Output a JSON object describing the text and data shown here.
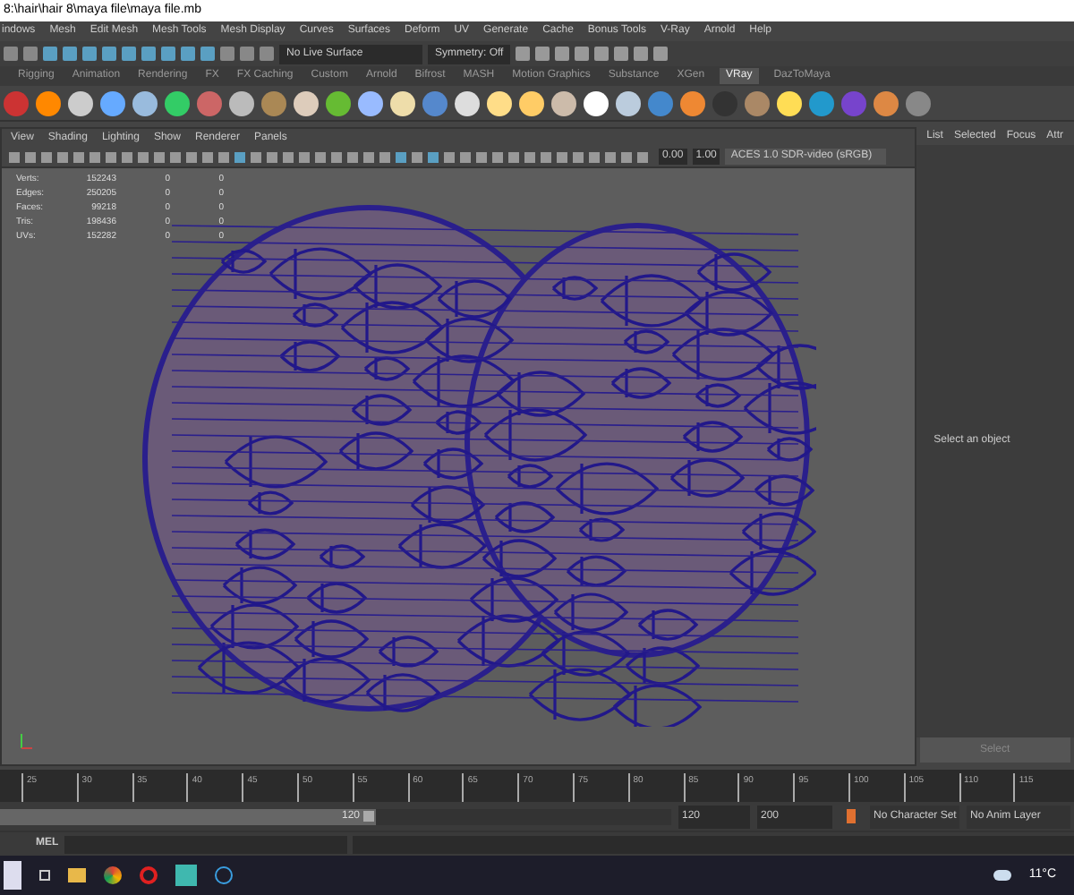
{
  "window": {
    "title": "8:\\hair\\hair 8\\maya file\\maya file.mb"
  },
  "menu_bar": [
    "indows",
    "Mesh",
    "Edit Mesh",
    "Mesh Tools",
    "Mesh Display",
    "Curves",
    "Surfaces",
    "Deform",
    "UV",
    "Generate",
    "Cache",
    "Bonus Tools",
    "V-Ray",
    "Arnold",
    "Help"
  ],
  "status_line": {
    "live_surface": "No Live Surface",
    "symmetry": "Symmetry: Off"
  },
  "shelf_tabs": [
    {
      "label": "Rigging",
      "selected": false
    },
    {
      "label": "Animation",
      "selected": false
    },
    {
      "label": "Rendering",
      "selected": false
    },
    {
      "label": "FX",
      "selected": false
    },
    {
      "label": "FX Caching",
      "selected": false
    },
    {
      "label": "Custom",
      "selected": false
    },
    {
      "label": "Arnold",
      "selected": false
    },
    {
      "label": "Bifrost",
      "selected": false
    },
    {
      "label": "MASH",
      "selected": false
    },
    {
      "label": "Motion Graphics",
      "selected": false
    },
    {
      "label": "Substance",
      "selected": false
    },
    {
      "label": "XGen",
      "selected": false
    },
    {
      "label": "VRay",
      "selected": true
    },
    {
      "label": "DazToMaya",
      "selected": false
    }
  ],
  "viewport": {
    "menu": [
      "View",
      "Shading",
      "Lighting",
      "Show",
      "Renderer",
      "Panels"
    ],
    "exposure": "0.00",
    "gamma": "1.00",
    "color_space": "ACES 1.0 SDR-video (sRGB)",
    "hud": [
      {
        "label": "Verts:",
        "values": [
          "152243",
          "0",
          "0"
        ]
      },
      {
        "label": "Edges:",
        "values": [
          "250205",
          "0",
          "0"
        ]
      },
      {
        "label": "Faces:",
        "values": [
          "99218",
          "0",
          "0"
        ]
      },
      {
        "label": "Tris:",
        "values": [
          "198436",
          "0",
          "0"
        ]
      },
      {
        "label": "UVs:",
        "values": [
          "152282",
          "0",
          "0"
        ]
      }
    ]
  },
  "attribute_panel": {
    "tabs": [
      "List",
      "Selected",
      "Focus",
      "Attr"
    ],
    "message": "Select an object",
    "button": "Select"
  },
  "time_slider": {
    "ticks": [
      "25",
      "30",
      "35",
      "40",
      "45",
      "50",
      "55",
      "60",
      "65",
      "70",
      "75",
      "80",
      "85",
      "90",
      "95",
      "100",
      "105",
      "110",
      "115"
    ]
  },
  "range_slider": {
    "level": 0.56,
    "handle": "120",
    "end": "120",
    "max": "200",
    "character_set": "No Character Set",
    "anim_layer": "No Anim Layer"
  },
  "command_line": {
    "label": "MEL"
  },
  "taskbar": {
    "weather": "11°C"
  }
}
